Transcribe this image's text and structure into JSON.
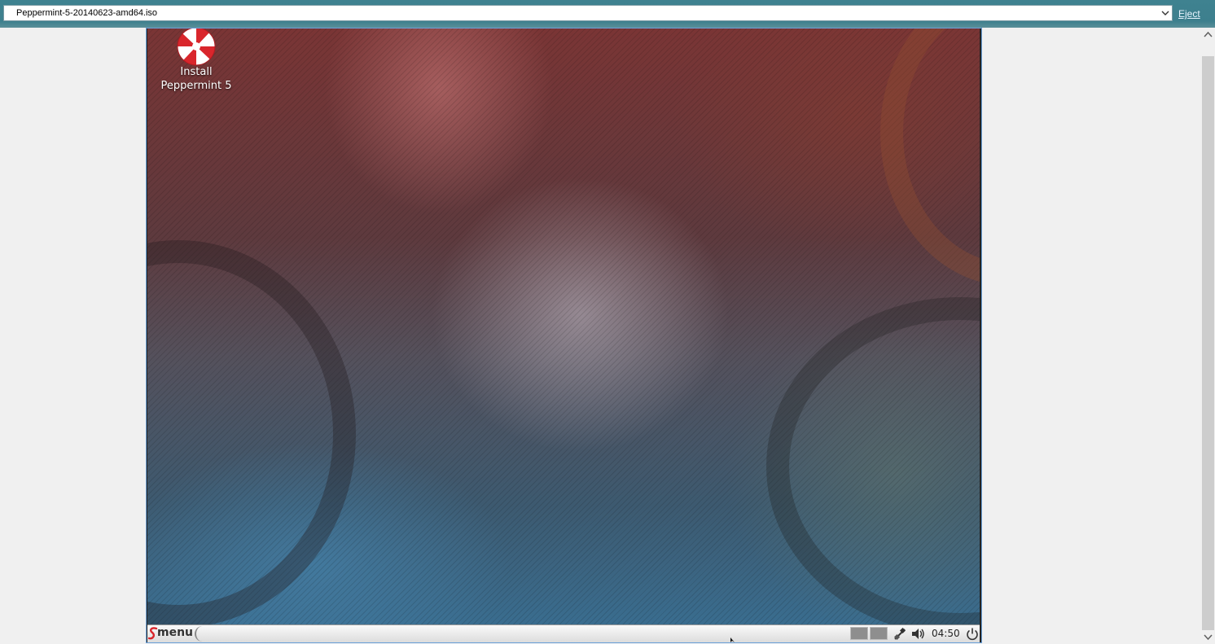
{
  "topbar": {
    "iso_selected": "Peppermint-5-20140623-amd64.iso",
    "eject_label": "Eject",
    "bg_color": "#3d7f8d"
  },
  "vm": {
    "desktop_icons": [
      {
        "label_line1": "Install",
        "label_line2": "Peppermint 5",
        "icon": "peppermint-installer-icon"
      }
    ],
    "panel": {
      "menu_label": "menu",
      "clock": "04:50",
      "workspaces": 2,
      "tray_icons": [
        "network-icon",
        "volume-icon",
        "power-icon"
      ]
    }
  },
  "colors": {
    "accent_red": "#d9262c",
    "frame_border": "#6aa0d8"
  }
}
